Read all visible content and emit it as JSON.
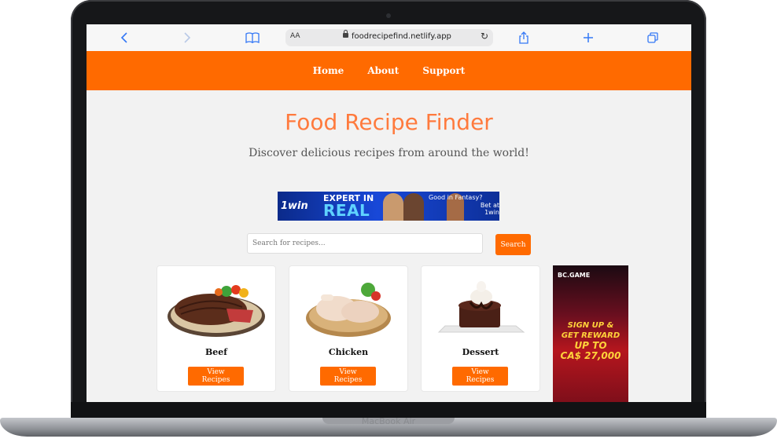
{
  "device": {
    "label": "MacBook Air"
  },
  "browser": {
    "url_prefix": "AA",
    "url": "foodrecipefind.netlify.app",
    "icons": [
      "back-icon",
      "forward-icon",
      "book-icon",
      "lock-icon",
      "reload-icon",
      "share-icon",
      "new-tab-icon",
      "tabs-icon"
    ]
  },
  "nav": {
    "items": [
      {
        "label": "Home"
      },
      {
        "label": "About"
      },
      {
        "label": "Support"
      }
    ]
  },
  "hero": {
    "title": "Food Recipe Finder",
    "subtitle": "Discover delicious recipes from around the world!"
  },
  "ad_banner": {
    "brand": "1win",
    "headline1": "EXPERT IN",
    "headline2": "REAL",
    "side1": "Good in Fantasy?",
    "side2": "Bet at 1win"
  },
  "search": {
    "placeholder": "Search for recipes...",
    "button_label": "Search"
  },
  "categories": [
    {
      "name": "Beef",
      "button": "View Recipes"
    },
    {
      "name": "Chicken",
      "button": "View Recipes"
    },
    {
      "name": "Dessert",
      "button": "View Recipes"
    }
  ],
  "ad_side": {
    "logo": "BC.GAME",
    "line1": "SIGN UP &",
    "line2": "GET REWARD",
    "line3": "UP TO",
    "line4": "CA$ 27,000"
  },
  "colors": {
    "accent": "#ff6a00",
    "title": "#ff7a3d",
    "page_bg": "#f2f2f2",
    "safari_blue": "#3478f6"
  }
}
